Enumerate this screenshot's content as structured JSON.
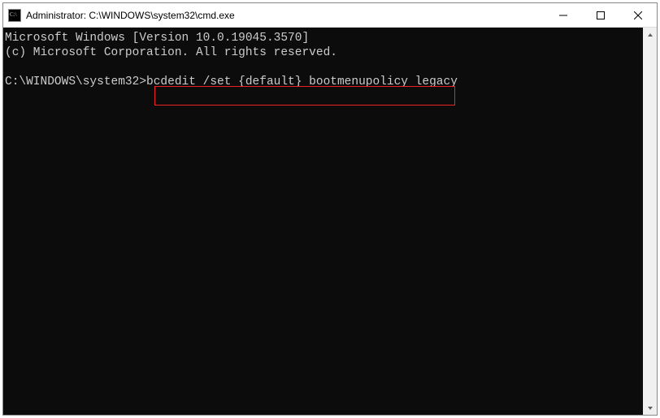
{
  "window": {
    "title": "Administrator: C:\\WINDOWS\\system32\\cmd.exe"
  },
  "terminal": {
    "line1": "Microsoft Windows [Version 10.0.19045.3570]",
    "line2": "(c) Microsoft Corporation. All rights reserved.",
    "blank": "",
    "prompt": "C:\\WINDOWS\\system32>",
    "command": "bcdedit /set {default} bootmenupolicy legacy"
  },
  "icons": {
    "cmd": "cmd-icon",
    "minimize": "minimize-icon",
    "maximize": "maximize-icon",
    "close": "close-icon",
    "scroll_up": "scroll-up-icon",
    "scroll_down": "scroll-down-icon"
  }
}
